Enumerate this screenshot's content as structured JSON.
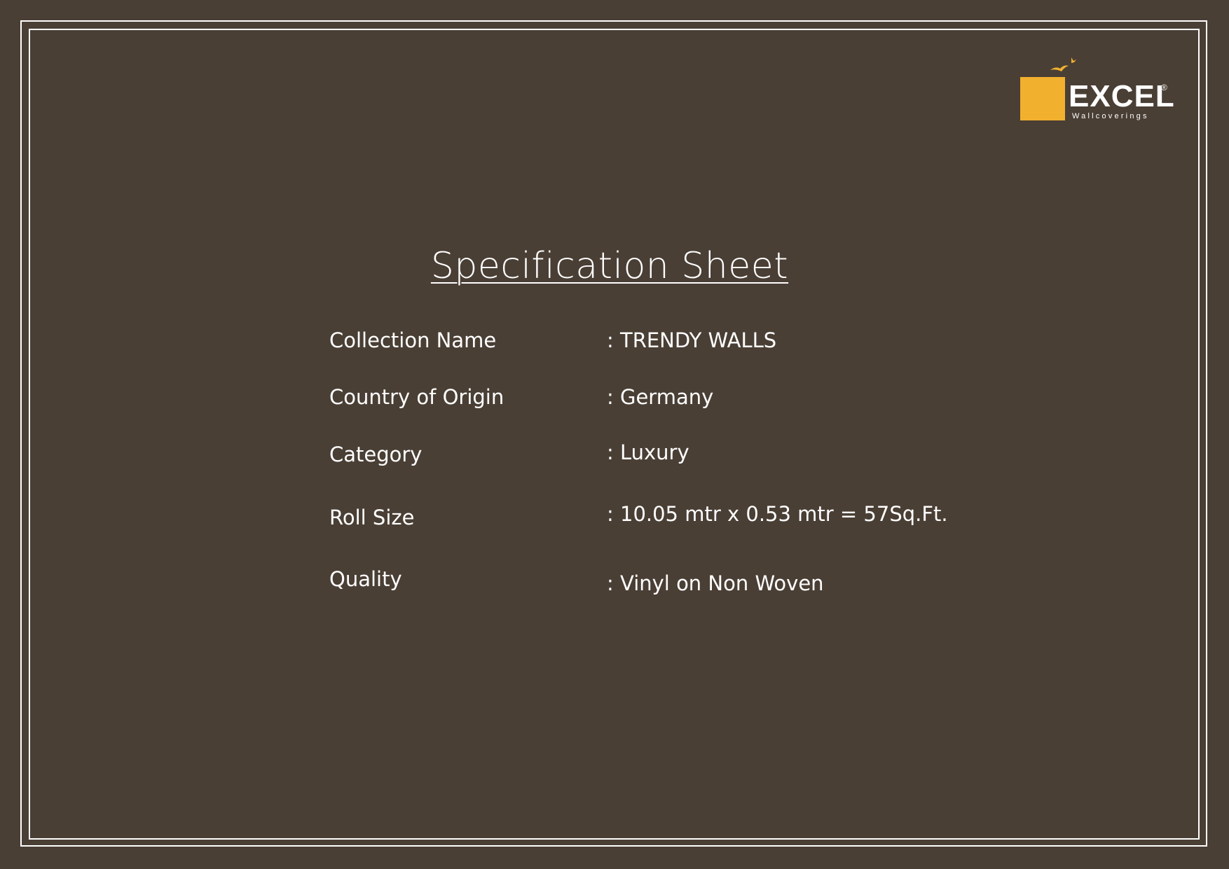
{
  "brand": {
    "name": "EXCEL",
    "registered_mark": "®",
    "tagline": "Wallcoverings",
    "accent_color": "#f2b02f",
    "background_color": "#4a3f35"
  },
  "title": "Specification Sheet",
  "specs": [
    {
      "label": "Collection Name",
      "value": ": TRENDY WALLS"
    },
    {
      "label": "Country of Origin",
      "value": ": Germany"
    },
    {
      "label": "Category",
      "value": ": Luxury"
    },
    {
      "label": "Roll Size",
      "value": ": 10.05 mtr x 0.53 mtr = 57Sq.Ft."
    },
    {
      "label": "Quality",
      "value": ": Vinyl on Non Woven"
    }
  ]
}
